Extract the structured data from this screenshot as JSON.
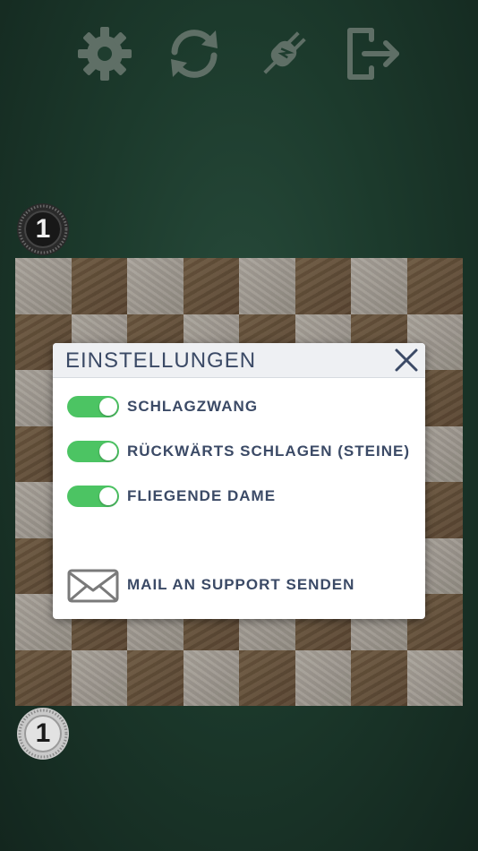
{
  "toolbar": {
    "settings_icon": "gear-icon",
    "restart_icon": "refresh-icon",
    "connection_icon": "plug-icon",
    "exit_icon": "logout-icon",
    "icon_color": "#5f6f66"
  },
  "counters": {
    "top_player": "1",
    "bottom_player": "1"
  },
  "board": {
    "rows": 8,
    "cols": 8,
    "light_color": "#a39e96",
    "dark_color": "#65513a"
  },
  "settings_dialog": {
    "title": "EINSTELLUNGEN",
    "close_icon": "close-icon",
    "options": [
      {
        "label": "SCHLAGZWANG",
        "enabled": true
      },
      {
        "label": "RÜCKWÄRTS SCHLAGEN (STEINE)",
        "enabled": true
      },
      {
        "label": "FLIEGENDE DAME",
        "enabled": true
      }
    ],
    "support": {
      "label": "MAIL AN SUPPORT SENDEN",
      "icon": "mail-icon"
    },
    "toggle_on_color": "#4cc463",
    "text_color": "#3b4a66"
  }
}
